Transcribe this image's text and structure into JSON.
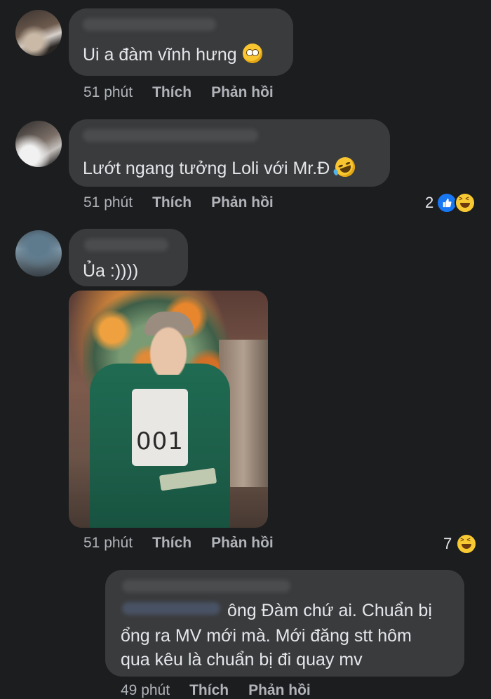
{
  "comments": [
    {
      "text": "Ui a đàm vĩnh hưng",
      "emoji": "face-with-rolling-eyes",
      "time": "51 phút",
      "like": "Thích",
      "reply": "Phản hồi"
    },
    {
      "text": "Lướt ngang tưởng Loli với Mr.Đ",
      "emoji": "rolling-on-floor-laughing",
      "time": "51 phút",
      "like": "Thích",
      "reply": "Phản hồi",
      "reaction_count": "2"
    },
    {
      "text": "Ủa :))))",
      "time": "51 phút",
      "like": "Thích",
      "reply": "Phản hồi",
      "reaction_count": "7"
    },
    {
      "line1": "ông Đàm chứ ai. Chuẩn bị",
      "line2": "ổng ra MV mới mà. Mới đăng stt hôm",
      "line3": "qua kêu là chuẩn bị đi quay mv",
      "time": "49 phút",
      "like": "Thích",
      "reply": "Phản hồi"
    }
  ]
}
